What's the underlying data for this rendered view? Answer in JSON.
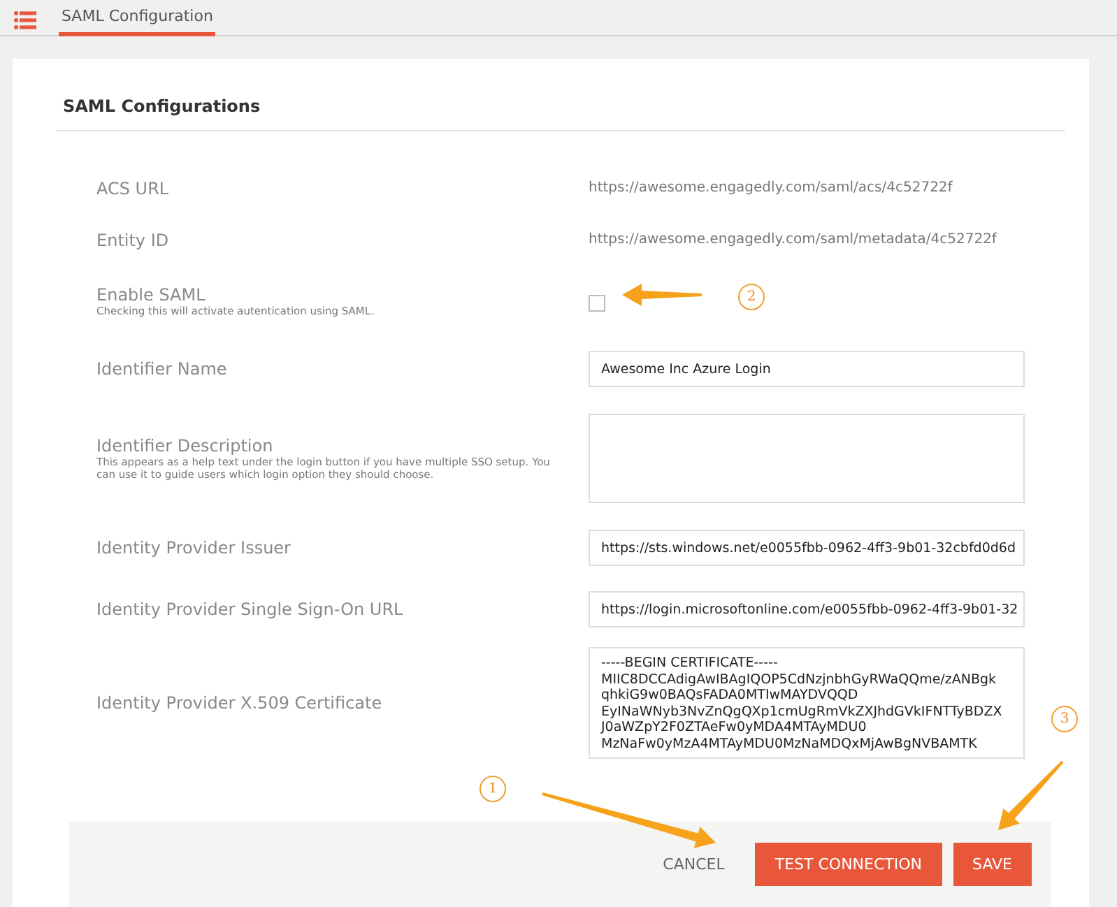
{
  "tabs": [
    {
      "label": "SAML Configuration",
      "selected": true
    }
  ],
  "section_title": "SAML Configurations",
  "fields": [
    {
      "kind": "text",
      "label": "ACS URL",
      "value": "https://awesome.engagedly.com/saml/acs/4c52722f"
    },
    {
      "kind": "text",
      "label": "Entity ID",
      "value": "https://awesome.engagedly.com/saml/metadata/4c52722f"
    },
    {
      "kind": "checkbox",
      "label": "Enable SAML",
      "hint": "Checking this will activate autentication using SAML.",
      "checked": false
    },
    {
      "kind": "input",
      "label": "Identifier Name",
      "value": "Awesome Inc Azure Login"
    },
    {
      "kind": "textarea",
      "label": "Identifier Description",
      "hint": "This appears as a help text under the login button if you have multiple SSO setup. You can use it to guide users which login option they should choose."
    },
    {
      "kind": "input",
      "label": "Identity Provider Issuer",
      "value": "https://sts.windows.net/e0055fbb-0962-4ff3-9b01-32cbfd0d6d"
    },
    {
      "kind": "input",
      "label": "Identity Provider Single Sign-On URL",
      "value": "https://login.microsoftonline.com/e0055fbb-0962-4ff3-9b01-32"
    },
    {
      "kind": "textarea",
      "label": "Identity Provider X.509 Certificate",
      "lines": [
        "-----BEGIN CERTIFICATE-----",
        "MIIC8DCCAdigAwIBAgIQOP5CdNzjnbhGyRWaQQme/zANBgk",
        "qhkiG9w0BAQsFADA0MTIwMAYDVQQD",
        "EyINaWNyb3NvZnQgQXp1cmUgRmVkZXJhdGVkIFNTTyBDZX",
        "J0aWZpY2F0ZTAeFw0yMDA4MTAyMDU0",
        "MzNaFw0yMzA4MTAyMDU0MzNaMDQxMjAwBgNVBAMTK"
      ]
    }
  ],
  "buttons": [
    {
      "kind": "plain",
      "label": "CANCEL"
    },
    {
      "kind": "primary",
      "label": "TEST CONNECTION"
    },
    {
      "kind": "primary",
      "label": "SAVE"
    }
  ],
  "callouts": [
    "1",
    "2",
    "3"
  ]
}
